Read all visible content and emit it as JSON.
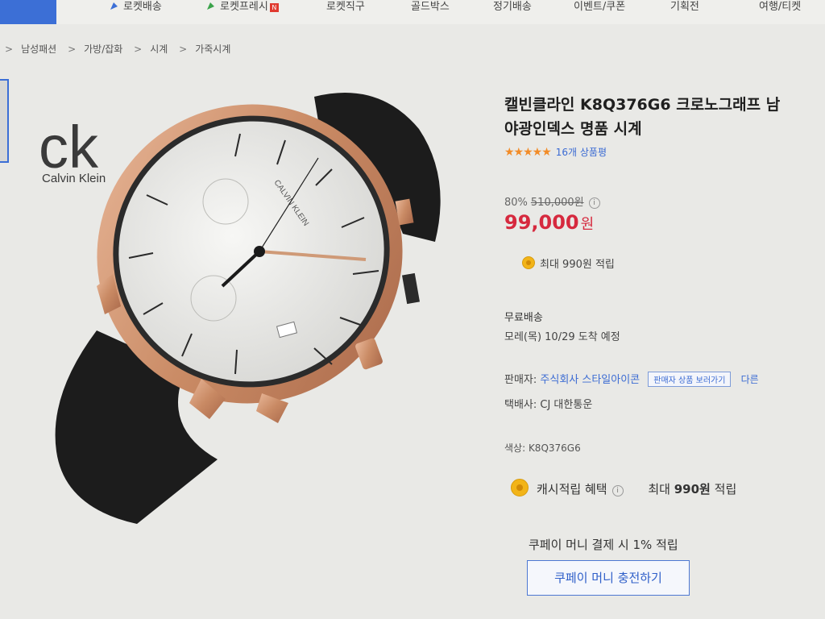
{
  "nav": {
    "items": [
      {
        "label": "로켓배송",
        "icon": "rocket-icon"
      },
      {
        "label": "로켓프레시",
        "icon": "fresh-icon",
        "badge": "N"
      },
      {
        "label": "로켓직구"
      },
      {
        "label": "골드박스"
      },
      {
        "label": "정기배송"
      },
      {
        "label": "이벤트/쿠폰"
      },
      {
        "label": "기획전"
      },
      {
        "label": "여행/티켓"
      }
    ]
  },
  "breadcrumb": {
    "sep": ">",
    "items": [
      "남성패션",
      "가방/잡화",
      "시계",
      "가죽시계"
    ]
  },
  "product": {
    "brand_short": "ck",
    "brand_full": "Calvin Klein",
    "dial_brand": "CALVIN KLEIN",
    "title_line1": "캘빈클라인 K8Q376G6 크로노그래프 남",
    "title_line2": "야광인덱스 명품 시계",
    "rating_stars": 4.5,
    "review_count": "16개 상품평",
    "discount_rate": "80%",
    "original_price": "510,000원",
    "price": "99,000",
    "price_unit": "원",
    "points_text": "최대 990원 적립",
    "shipping_label": "무료배송",
    "delivery_text": "모레(목) 10/29 도착 예정",
    "seller_label": "판매자:",
    "seller_name": "주식회사 스타일아이콘",
    "seller_button": "판매자 상품 보러가기",
    "other_sellers": "다른",
    "courier_text": "택배사: CJ 대한통운",
    "color_text": "색상: K8Q376G6",
    "cashback_label": "캐시적립 혜택",
    "cashback_max_prefix": "최대",
    "cashback_max_value": "990원",
    "cashback_max_suffix": "적립",
    "coupay_text": "쿠페이 머니 결제 시 1% 적립",
    "coupay_button": "쿠페이 머니 충전하기"
  },
  "colors": {
    "accent": "#3b6bd3",
    "price": "#d6293e",
    "star": "#f28c28",
    "coin": "#f2b418"
  }
}
